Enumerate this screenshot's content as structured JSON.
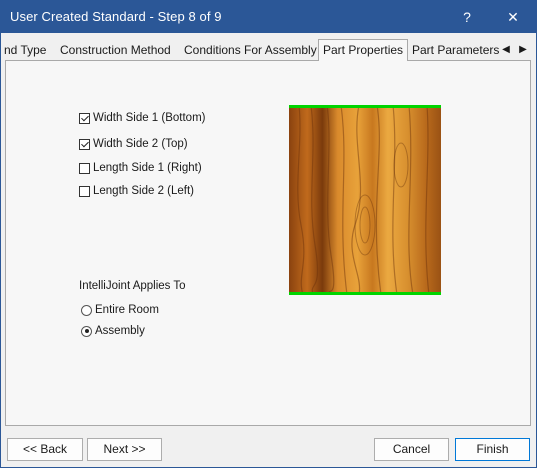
{
  "window": {
    "title": "User Created Standard - Step 8 of 9",
    "help_label": "?",
    "close_label": "✕"
  },
  "tabs": [
    {
      "label": "nd Type"
    },
    {
      "label": "Construction Method"
    },
    {
      "label": "Conditions For Assembly"
    },
    {
      "label": "Part Properties"
    },
    {
      "label": "Part Parameters"
    }
  ],
  "tab_scroll": {
    "left": "◀",
    "right": "▶"
  },
  "edges": [
    {
      "label": "Width Side 1 (Bottom)",
      "checked": true
    },
    {
      "label": "Width Side 2 (Top)",
      "checked": true
    },
    {
      "label": "Length Side 1 (Right)",
      "checked": false
    },
    {
      "label": "Length Side 2 (Left)",
      "checked": false
    }
  ],
  "intellijoint": {
    "label": "IntelliJoint Applies To",
    "options": [
      {
        "label": "Entire Room",
        "selected": false
      },
      {
        "label": "Assembly",
        "selected": true
      }
    ]
  },
  "buttons": {
    "back": "<< Back",
    "next": "Next >>",
    "cancel": "Cancel",
    "finish": "Finish"
  },
  "colors": {
    "titlebar": "#2b5797",
    "edge_highlight": "#00d400",
    "wood_light": "#e8a23a",
    "wood_dark": "#7a3a0c"
  }
}
